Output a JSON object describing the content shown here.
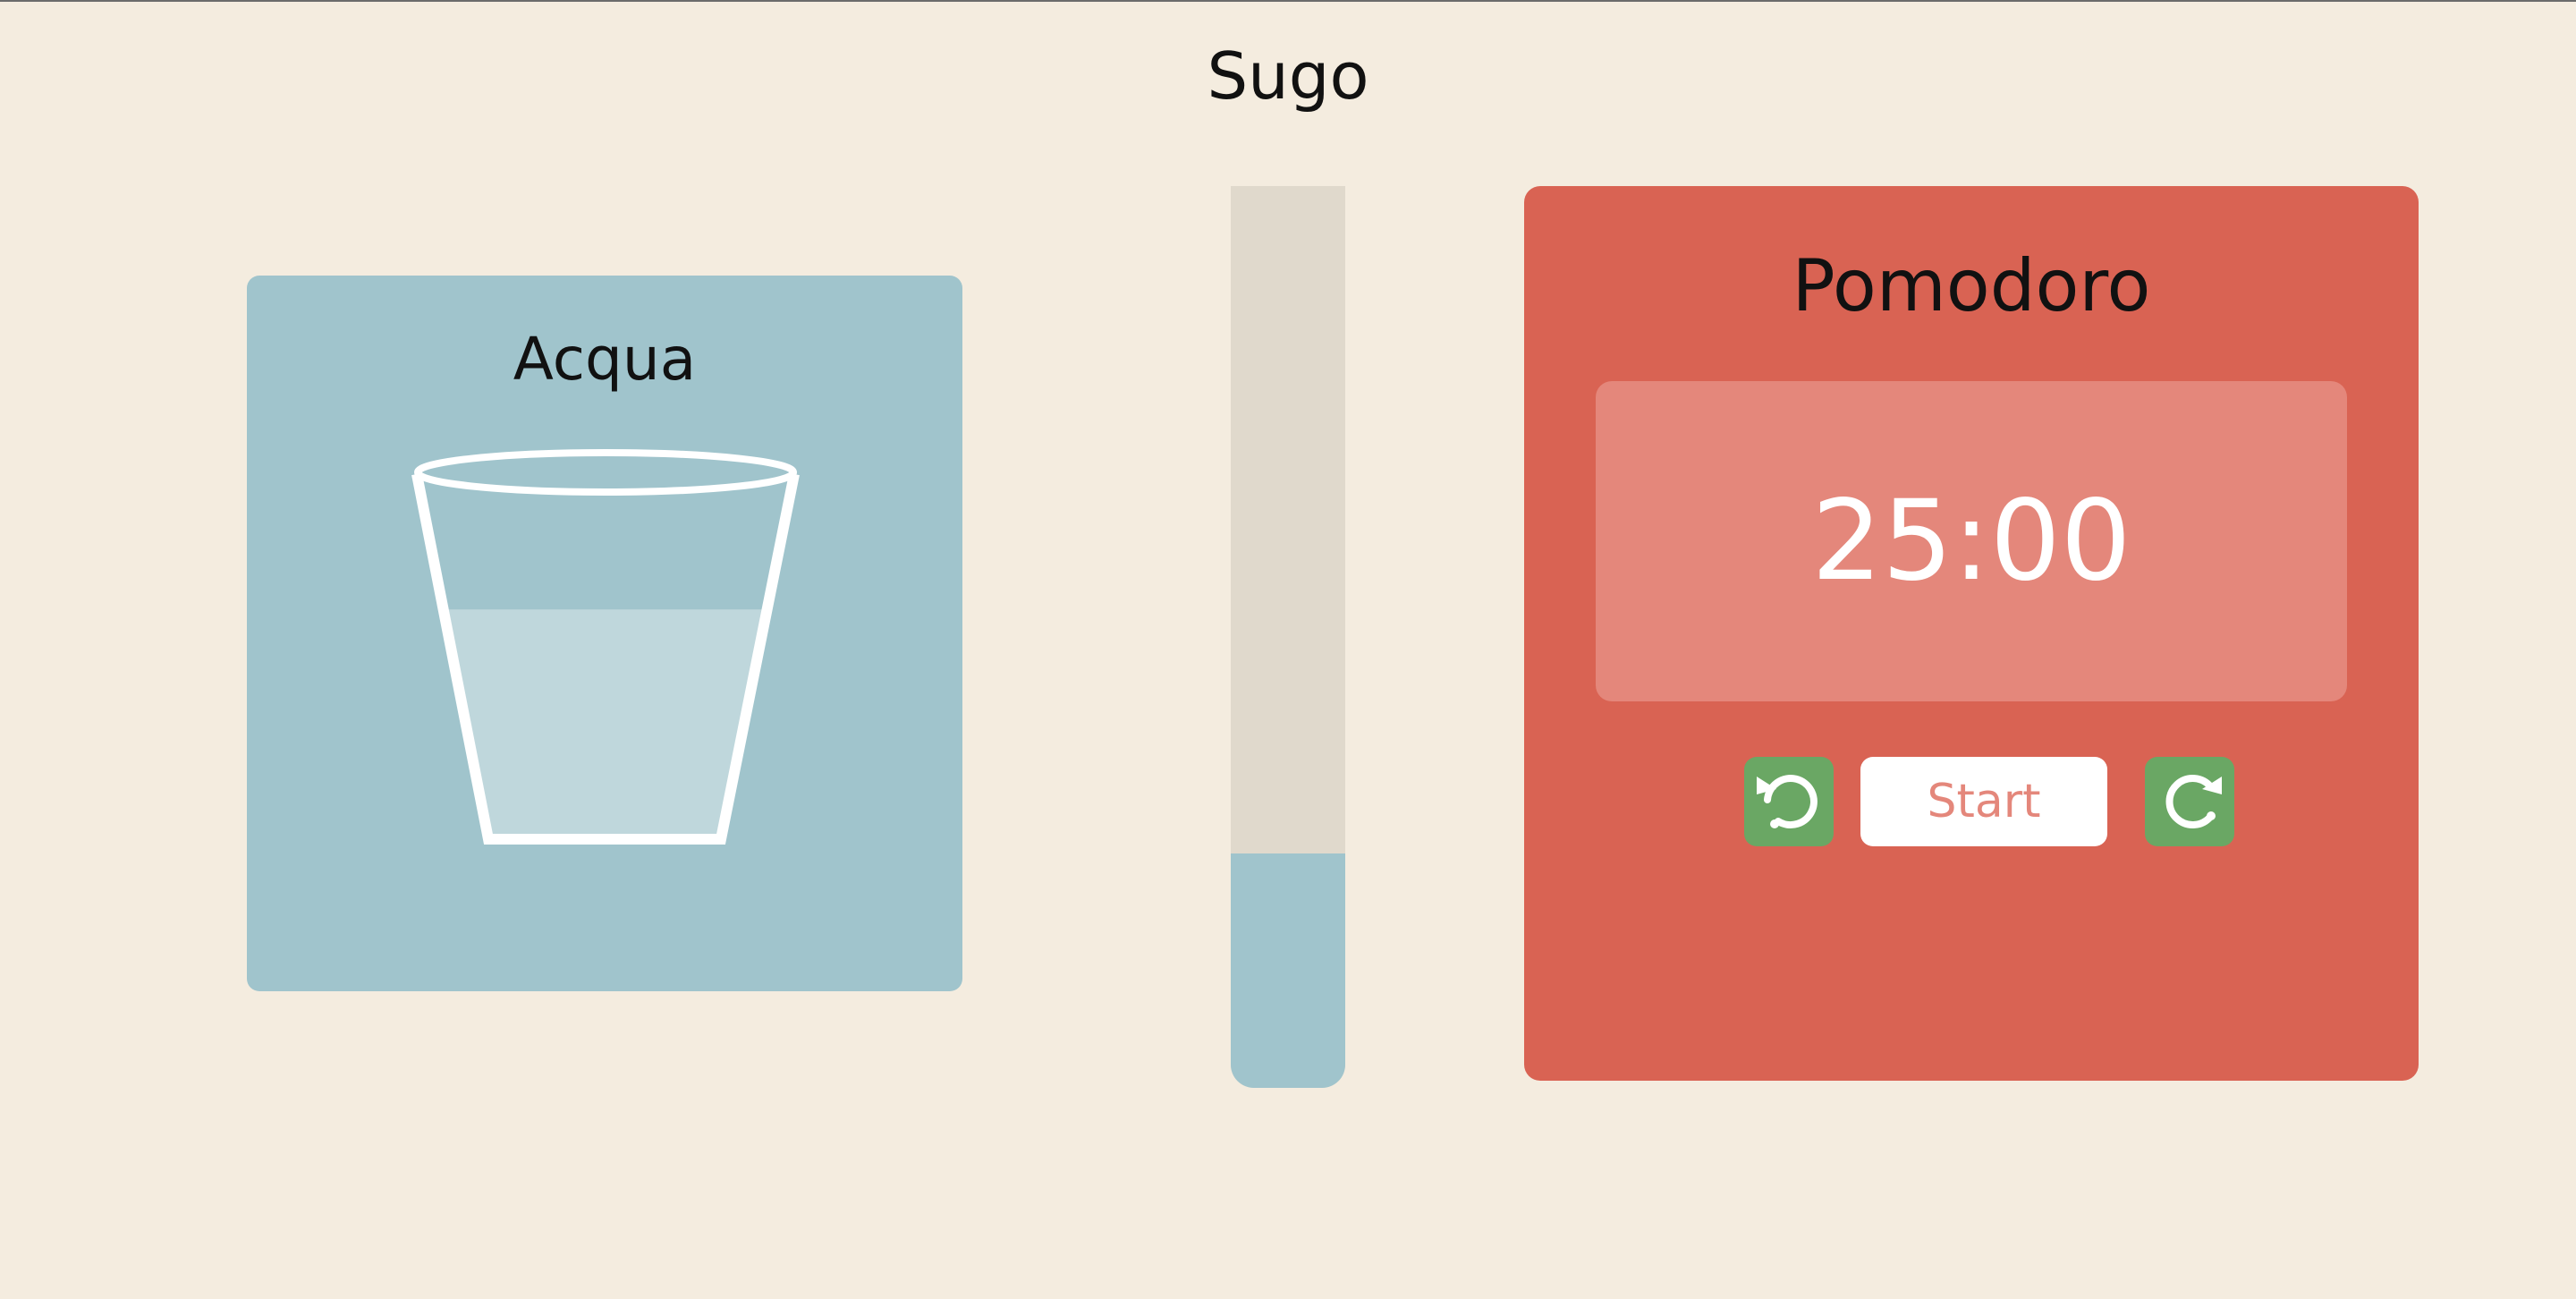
{
  "app": {
    "title": "Sugo"
  },
  "water": {
    "title": "Acqua",
    "fill_level": 0.64,
    "icon": "water-glass-icon"
  },
  "meter": {
    "fill_fraction": 0.26
  },
  "pomodoro": {
    "title": "Pomodoro",
    "time": "25:00",
    "start_label": "Start",
    "rewind_icon": "rotate-left-icon",
    "forward_icon": "rotate-right-icon"
  },
  "colors": {
    "background": "#f4ecdf",
    "water": "#a0c4cc",
    "meter_track": "#e0d9cc",
    "tomato": "#d96353",
    "timer_panel": "#e4877b",
    "button_green": "#6aa764"
  }
}
